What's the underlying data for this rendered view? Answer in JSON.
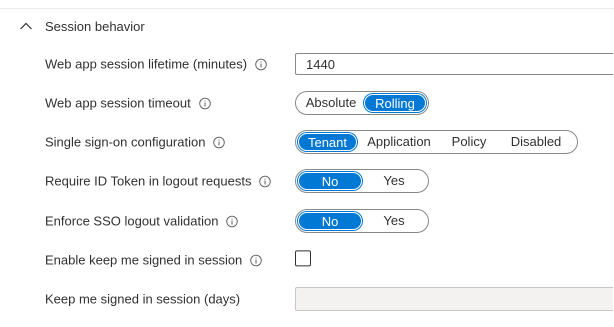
{
  "section": {
    "title": "Session behavior",
    "expanded_icon": "chevron-up-icon"
  },
  "settings": {
    "lifetime": {
      "label": "Web app session lifetime (minutes)",
      "value": "1440"
    },
    "timeout": {
      "label": "Web app session timeout",
      "options": [
        "Absolute",
        "Rolling"
      ],
      "selected": "Rolling"
    },
    "sso": {
      "label": "Single sign-on configuration",
      "options": [
        "Tenant",
        "Application",
        "Policy",
        "Disabled"
      ],
      "selected": "Tenant"
    },
    "id_token": {
      "label": "Require ID Token in logout requests",
      "options": [
        "No",
        "Yes"
      ],
      "selected": "No"
    },
    "sso_logout": {
      "label": "Enforce SSO logout validation",
      "options": [
        "No",
        "Yes"
      ],
      "selected": "No"
    },
    "kmsi": {
      "label": "Enable keep me signed in session",
      "checked": false
    },
    "kmsi_days": {
      "label": "Keep me signed in session (days)",
      "value": ""
    }
  },
  "icons": {
    "info": "info-icon"
  },
  "colors": {
    "accent": "#0078d4",
    "text": "#323130",
    "border": "#8a8886",
    "disabled_bg": "#f3f2f1"
  }
}
